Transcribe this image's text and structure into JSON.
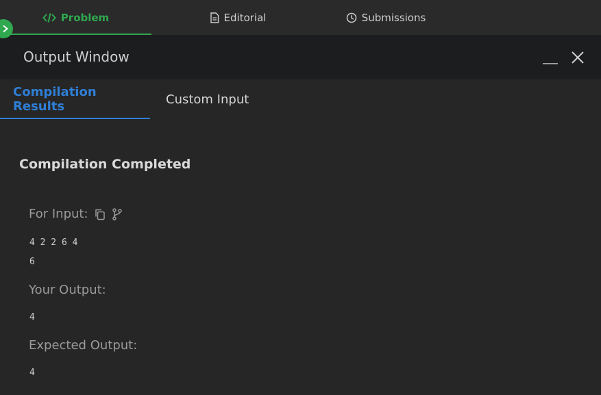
{
  "top_tabs": [
    {
      "label": "Problem",
      "icon": "code-icon",
      "active": true
    },
    {
      "label": "Editorial",
      "icon": "document-icon",
      "active": false
    },
    {
      "label": "Submissions",
      "icon": "clock-icon",
      "active": false
    }
  ],
  "window": {
    "title": "Output Window"
  },
  "sub_tabs": [
    {
      "label": "Compilation Results",
      "active": true
    },
    {
      "label": "Custom Input",
      "active": false
    }
  ],
  "result": {
    "status": "Compilation Completed",
    "input_label": "For Input:",
    "input_lines": [
      "4 2 2 6 4",
      "6"
    ],
    "your_output_label": "Your Output:",
    "your_output": "4",
    "expected_output_label": "Expected Output:",
    "expected_output": "4"
  },
  "colors": {
    "accent_green": "#2fa84f",
    "accent_blue": "#2f7fd6",
    "background": "#262626",
    "header_background": "#1c1d1f"
  }
}
